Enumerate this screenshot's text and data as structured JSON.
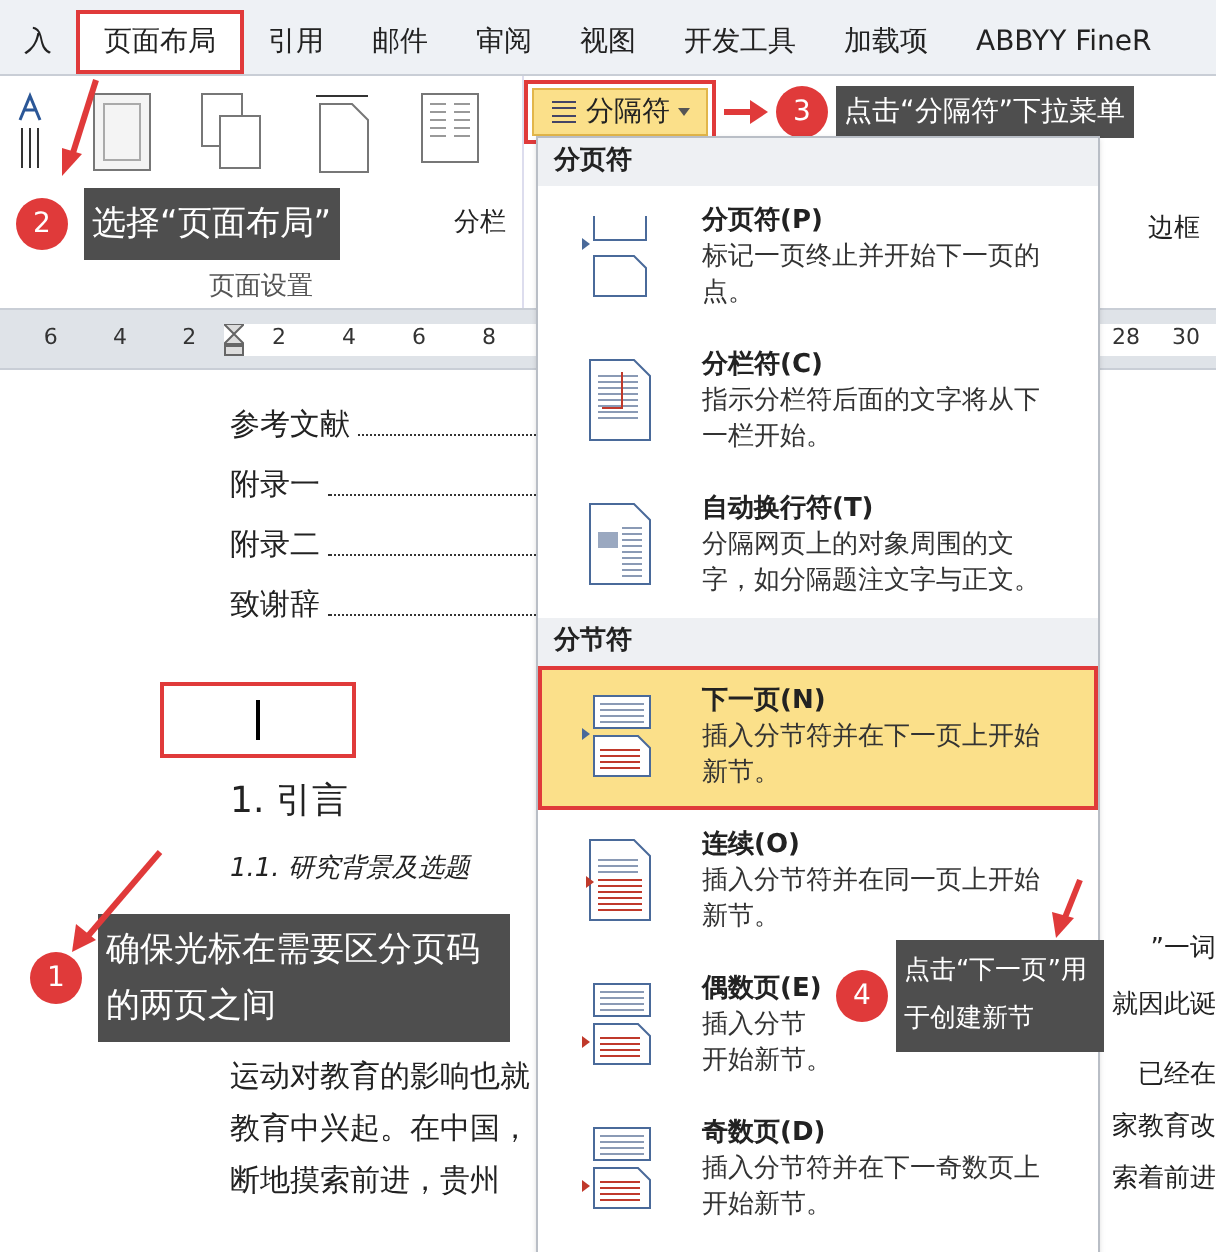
{
  "tabs": [
    {
      "label": "入",
      "selected": false
    },
    {
      "label": "页面布局",
      "selected": true
    },
    {
      "label": "引用",
      "selected": false
    },
    {
      "label": "邮件",
      "selected": false
    },
    {
      "label": "审阅",
      "selected": false
    },
    {
      "label": "视图",
      "selected": false
    },
    {
      "label": "开发工具",
      "selected": false
    },
    {
      "label": "加载项",
      "selected": false
    },
    {
      "label": "ABBYY FineR",
      "selected": false
    }
  ],
  "ribbon": {
    "columns_label": "分栏",
    "group_label": "页面设置",
    "break_button": {
      "label": "分隔符",
      "expanded": true
    },
    "border_label": "边框"
  },
  "ruler": {
    "left_ticks": [
      "6",
      "4",
      "2"
    ],
    "right_ticks": [
      "2",
      "4",
      "6",
      "8"
    ],
    "far_ticks": [
      "28",
      "30"
    ]
  },
  "document": {
    "toc": [
      "参考文献",
      "附录一",
      "附录二",
      "致谢辞"
    ],
    "heading": "1. 引言",
    "subheading": "1.1. 研究背景及选题",
    "side_texts": [
      "”一词",
      "就因此诞"
    ],
    "rows": [
      {
        "left": "运动对教育的影响也就",
        "right": "已经在"
      },
      {
        "left": "教育中兴起。在中国，",
        "right": "家教育改"
      },
      {
        "left": "断地摸索前进，贵州",
        "right": "索着前进"
      }
    ]
  },
  "menu": {
    "sections": [
      {
        "title": "分页符",
        "items": [
          {
            "kind": "page",
            "name": "分页符(P)",
            "desc": [
              "标记一页终止并开始下一页的",
              "点。"
            ],
            "selected": false
          },
          {
            "kind": "column",
            "name": "分栏符(C)",
            "desc": [
              "指示分栏符后面的文字将从下",
              "一栏开始。"
            ],
            "selected": false
          },
          {
            "kind": "wrap",
            "name": "自动换行符(T)",
            "desc": [
              "分隔网页上的对象周围的文",
              "字，如分隔题注文字与正文。"
            ],
            "selected": false
          }
        ]
      },
      {
        "title": "分节符",
        "items": [
          {
            "kind": "next",
            "name": "下一页(N)",
            "desc": [
              "插入分节符并在下一页上开始",
              "新节。"
            ],
            "selected": true
          },
          {
            "kind": "continuous",
            "name": "连续(O)",
            "desc": [
              "插入分节符并在同一页上开始",
              "新节。"
            ],
            "selected": false
          },
          {
            "kind": "even",
            "name": "偶数页(E)",
            "desc": [
              "插入分节",
              "开始新节。"
            ],
            "selected": false
          },
          {
            "kind": "odd",
            "name": "奇数页(D)",
            "desc": [
              "插入分节符并在下一奇数页上",
              "开始新节。"
            ],
            "selected": false
          }
        ]
      }
    ]
  },
  "callouts": [
    {
      "number": "2",
      "text": "选择“页面布局”"
    },
    {
      "number": "3",
      "text": "点击“分隔符”下拉菜单"
    },
    {
      "number": "1",
      "text": "确保光标在需要区分页码的两页之间"
    },
    {
      "number": "4",
      "text": "点击“下一页”用于创建新节"
    }
  ]
}
